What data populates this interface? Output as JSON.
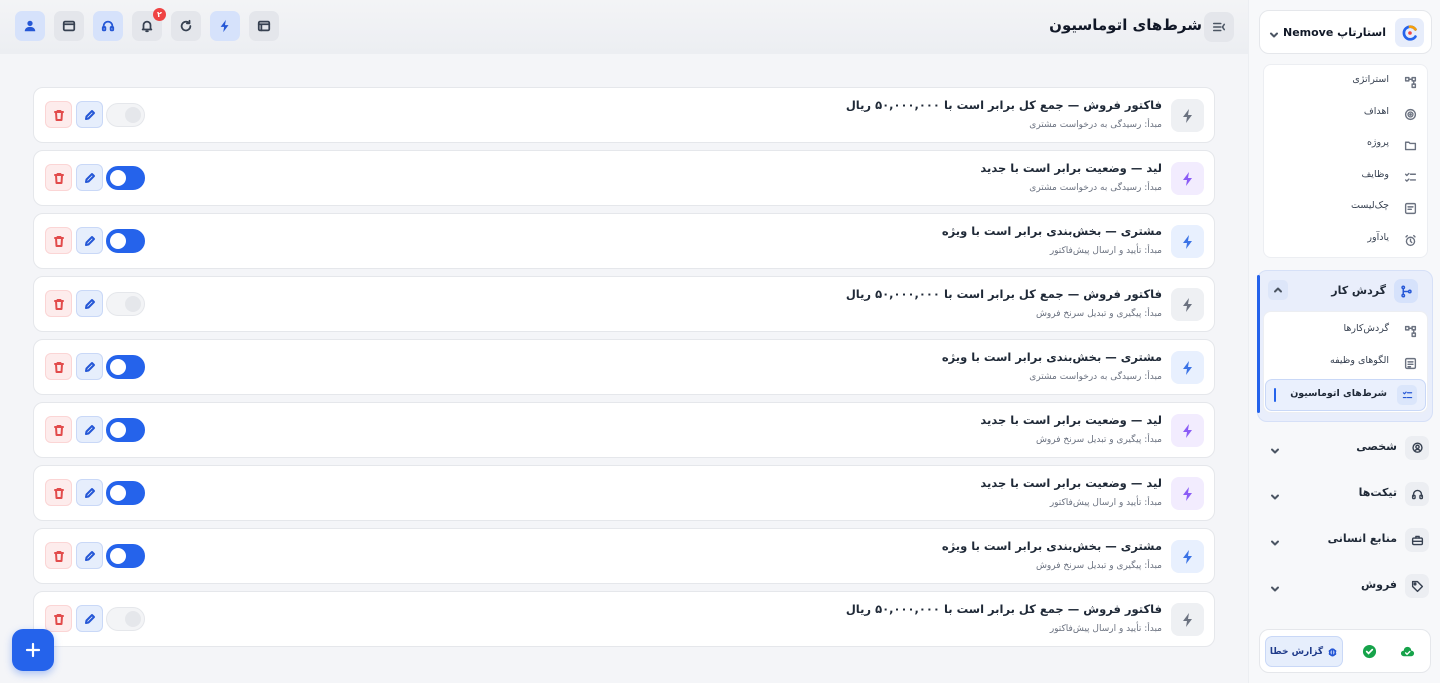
{
  "header": {
    "title": "شرط‌های اتوماسیون",
    "notification_count": "۲",
    "icons": [
      "user-icon",
      "window-icon",
      "headset-icon",
      "bell-icon",
      "refresh-icon",
      "bolt-icon",
      "browser-icon",
      "sidebar-collapse-icon"
    ]
  },
  "rules": [
    {
      "title": "فاکتور فروش — جمع کل برابر است با ۵۰,۰۰۰,۰۰۰ ریال",
      "source": "مبدأ: رسیدگی به درخواست مشتری",
      "enabled": false,
      "icon_color": "gray"
    },
    {
      "title": "لید — وضعیت برابر است با جدید",
      "source": "مبدأ: رسیدگی به درخواست مشتری",
      "enabled": true,
      "icon_color": "purple"
    },
    {
      "title": "مشتری — بخش‌بندی برابر است با ویژه",
      "source": "مبدأ: تأیید و ارسال پیش‌فاکتور",
      "enabled": true,
      "icon_color": "blue"
    },
    {
      "title": "فاکتور فروش — جمع کل برابر است با ۵۰,۰۰۰,۰۰۰ ریال",
      "source": "مبدأ: پیگیری و تبدیل سرنخ فروش",
      "enabled": false,
      "icon_color": "gray"
    },
    {
      "title": "مشتری — بخش‌بندی برابر است با ویژه",
      "source": "مبدأ: رسیدگی به درخواست مشتری",
      "enabled": true,
      "icon_color": "blue"
    },
    {
      "title": "لید — وضعیت برابر است با جدید",
      "source": "مبدأ: پیگیری و تبدیل سرنخ فروش",
      "enabled": true,
      "icon_color": "purple"
    },
    {
      "title": "لید — وضعیت برابر است با جدید",
      "source": "مبدأ: تأیید و ارسال پیش‌فاکتور",
      "enabled": true,
      "icon_color": "purple"
    },
    {
      "title": "مشتری — بخش‌بندی برابر است با ویژه",
      "source": "مبدأ: پیگیری و تبدیل سرنخ فروش",
      "enabled": true,
      "icon_color": "blue"
    },
    {
      "title": "فاکتور فروش — جمع کل برابر است با ۵۰,۰۰۰,۰۰۰ ریال",
      "source": "مبدأ: تأیید و ارسال پیش‌فاکتور",
      "enabled": false,
      "icon_color": "gray"
    }
  ],
  "sidebar": {
    "project_name": "استارتاپ Nemove",
    "project_items": [
      {
        "label": "استراتژی",
        "icon": "strategy-icon"
      },
      {
        "label": "اهداف",
        "icon": "target-icon"
      },
      {
        "label": "پروژه",
        "icon": "folder-icon"
      },
      {
        "label": "وظایف",
        "icon": "tasks-icon"
      },
      {
        "label": "چک‌لیست",
        "icon": "checklist-icon"
      },
      {
        "label": "یادآور",
        "icon": "alarm-icon"
      }
    ],
    "workflow": {
      "label": "گردش کار",
      "items": [
        {
          "label": "گردش‌کارها",
          "icon": "workflows-icon"
        },
        {
          "label": "الگوهای وظیفه",
          "icon": "template-icon"
        },
        {
          "label": "شرط‌های اتوماسیون",
          "icon": "conditions-icon",
          "active": true
        }
      ]
    },
    "sections": [
      {
        "label": "شخصی",
        "icon": "person-icon"
      },
      {
        "label": "تیکت‌ها",
        "icon": "headset-icon"
      },
      {
        "label": "منابع انسانی",
        "icon": "briefcase-icon"
      },
      {
        "label": "فروش",
        "icon": "tag-icon"
      }
    ],
    "footer": {
      "report_label": "گزارش خطا"
    }
  },
  "colors": {
    "accent": "#2563eb",
    "danger": "#e24b4b",
    "purple": "#8b5cf6",
    "success": "#16a34a"
  }
}
